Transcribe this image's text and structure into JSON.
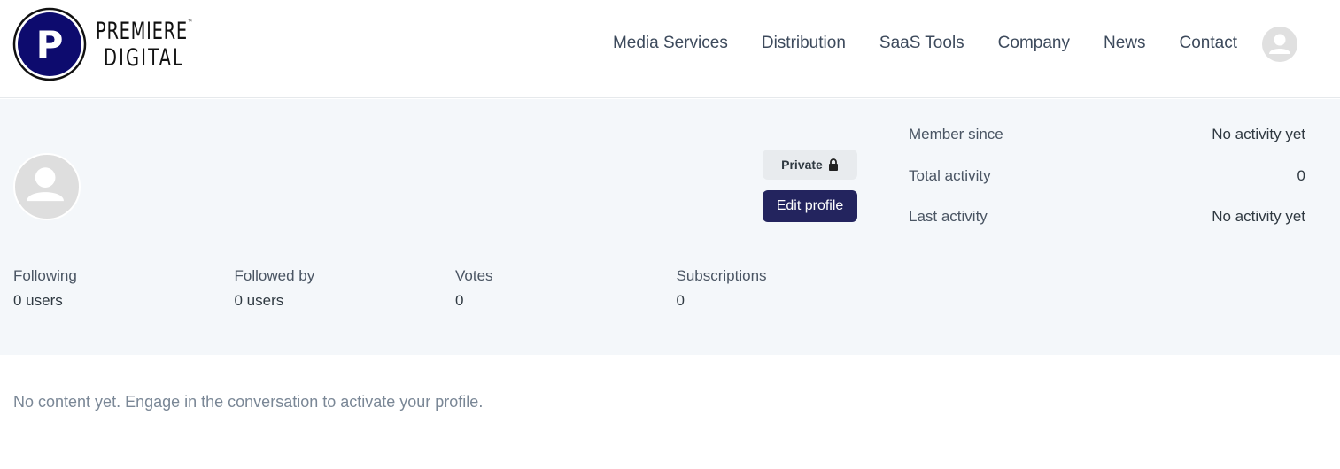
{
  "brand": {
    "logo_letter": "P",
    "name_line1": "PREMIERE",
    "name_line2": "DIGITAL",
    "trademark": "™",
    "logo_color": "#0d0b6e"
  },
  "nav": {
    "items": [
      "Media Services",
      "Distribution",
      "SaaS Tools",
      "Company",
      "News",
      "Contact"
    ]
  },
  "profile": {
    "visibility_label": "Private",
    "edit_button_label": "Edit profile",
    "accent_color": "#23245e"
  },
  "activity": [
    {
      "label": "Member since",
      "value": "No activity yet"
    },
    {
      "label": "Total activity",
      "value": "0"
    },
    {
      "label": "Last activity",
      "value": "No activity yet"
    }
  ],
  "stats": [
    {
      "label": "Following",
      "value": "0 users"
    },
    {
      "label": "Followed by",
      "value": "0 users"
    },
    {
      "label": "Votes",
      "value": "0"
    },
    {
      "label": "Subscriptions",
      "value": "0"
    }
  ],
  "empty_message": "No content yet. Engage in the conversation to activate your profile."
}
